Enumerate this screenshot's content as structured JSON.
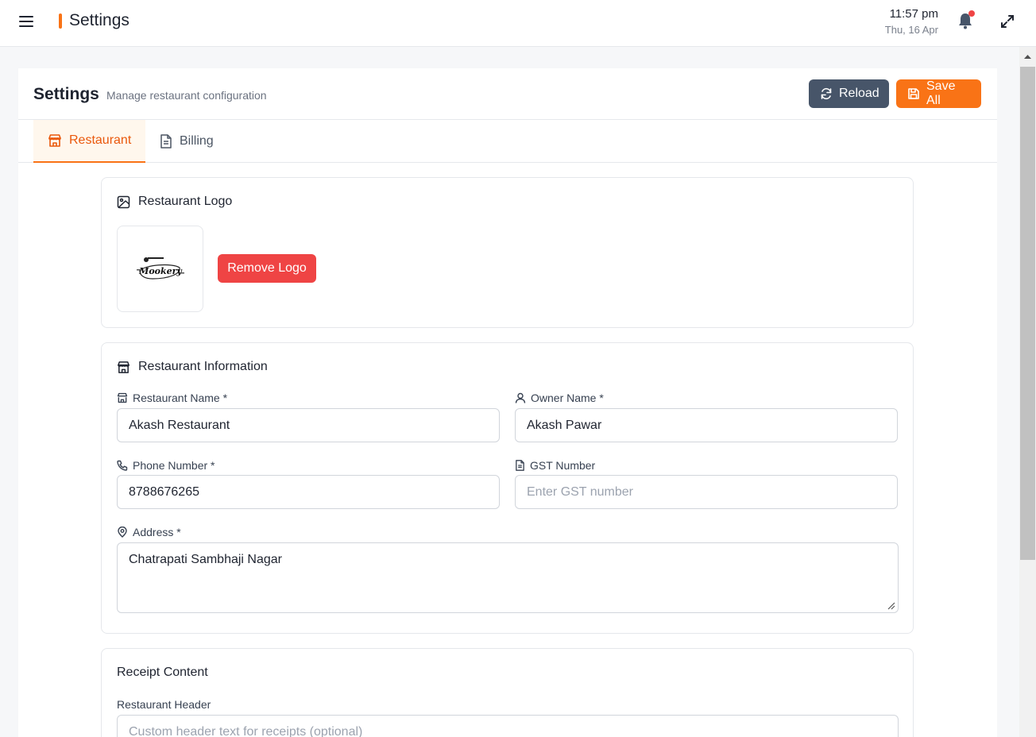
{
  "topbar": {
    "title": "Settings",
    "time": "11:57 pm",
    "date": "Thu, 16 Apr"
  },
  "header": {
    "title": "Settings",
    "subtitle": "Manage restaurant configuration",
    "reload_label": "Reload",
    "save_label": "Save All"
  },
  "tabs": [
    {
      "label": "Restaurant",
      "active": true
    },
    {
      "label": "Billing",
      "active": false
    }
  ],
  "logo_section": {
    "title": "Restaurant Logo",
    "logo_text": "Mookery",
    "remove_label": "Remove Logo"
  },
  "info_section": {
    "title": "Restaurant Information",
    "restaurant_name": {
      "label": "Restaurant Name *",
      "value": "Akash Restaurant"
    },
    "owner_name": {
      "label": "Owner Name *",
      "value": "Akash Pawar"
    },
    "phone": {
      "label": "Phone Number *",
      "value": "8788676265"
    },
    "gst": {
      "label": "GST Number",
      "placeholder": "Enter GST number"
    },
    "address": {
      "label": "Address *",
      "value": "Chatrapati Sambhaji Nagar"
    }
  },
  "receipt_section": {
    "title": "Receipt Content",
    "header_label": "Restaurant Header",
    "header_placeholder": "Custom header text for receipts (optional)"
  },
  "colors": {
    "accent": "#f97316",
    "danger": "#ef4444",
    "slate": "#475569"
  }
}
